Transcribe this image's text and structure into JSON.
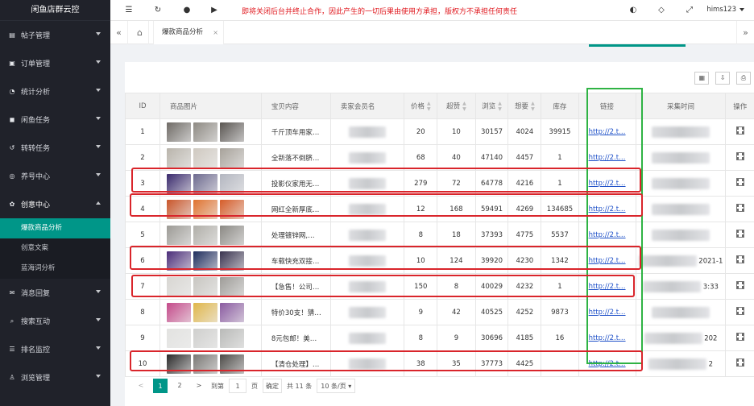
{
  "app": {
    "title": "闲鱼店群云控"
  },
  "sidebar": {
    "items": [
      {
        "label": "帖子管理",
        "icon": "doc-icon"
      },
      {
        "label": "订单管理",
        "icon": "order-icon"
      },
      {
        "label": "统计分析",
        "icon": "chart-icon"
      },
      {
        "label": "闲鱼任务",
        "icon": "task-icon"
      },
      {
        "label": "转转任务",
        "icon": "refresh-icon"
      },
      {
        "label": "养号中心",
        "icon": "account-icon"
      },
      {
        "label": "创意中心",
        "icon": "gear-icon"
      },
      {
        "label": "消息回复",
        "icon": "message-icon"
      },
      {
        "label": "搜索互动",
        "icon": "search-icon"
      },
      {
        "label": "排名监控",
        "icon": "rank-icon"
      },
      {
        "label": "浏览管理",
        "icon": "user-icon"
      }
    ],
    "sub_items": [
      {
        "label": "爆款商品分析",
        "active": true
      },
      {
        "label": "创意文案",
        "active": false
      },
      {
        "label": "蓝海词分析",
        "active": false
      }
    ]
  },
  "topbar": {
    "notice": "即将关闭后台并终止合作，因此产生的一切后果由使用方承担，版权方不承担任何责任",
    "user": "hims123"
  },
  "tabs": {
    "current": "爆款商品分析"
  },
  "table": {
    "headers": [
      "ID",
      "商品图片",
      "宝贝内容",
      "卖家会员名",
      "价格",
      "超赞",
      "浏览",
      "想要",
      "库存",
      "链接",
      "采集时间",
      "操作"
    ],
    "rows": [
      {
        "id": "1",
        "content": "千斤顶车用家…",
        "price": "20",
        "likes": "10",
        "views": "30157",
        "wants": "4024",
        "stock": "39915",
        "link": "http://2.t…",
        "time": "",
        "colors": [
          "#6f6b66",
          "#8d8982",
          "#5a5652"
        ]
      },
      {
        "id": "2",
        "content": "全新落不倒脐…",
        "price": "68",
        "likes": "40",
        "views": "47140",
        "wants": "4457",
        "stock": "1",
        "link": "http://2.t…",
        "time": "",
        "colors": [
          "#b9b4ab",
          "#cfc9c0",
          "#a7a29a"
        ]
      },
      {
        "id": "3",
        "content": "投影仪家用无…",
        "price": "279",
        "likes": "72",
        "views": "64778",
        "wants": "4216",
        "stock": "1",
        "link": "http://2.t…",
        "time": "",
        "colors": [
          "#3a2a6d",
          "#6d6a8f",
          "#b3b6c0"
        ]
      },
      {
        "id": "4",
        "content": "网红全新厚底…",
        "price": "12",
        "likes": "168",
        "views": "59491",
        "wants": "4269",
        "stock": "134685",
        "link": "http://2.t…",
        "time": "",
        "colors": [
          "#c9562a",
          "#e0732f",
          "#d65c28"
        ]
      },
      {
        "id": "5",
        "content": "处理镀锌网,…",
        "price": "8",
        "likes": "18",
        "views": "37393",
        "wants": "4775",
        "stock": "5537",
        "link": "http://2.t…",
        "time": "",
        "colors": [
          "#9c9a95",
          "#b0aea8",
          "#8b8984"
        ]
      },
      {
        "id": "6",
        "content": "车载快充双接…",
        "price": "10",
        "likes": "124",
        "views": "39920",
        "wants": "4230",
        "stock": "1342",
        "link": "http://2.t…",
        "time": "2021-1",
        "colors": [
          "#4b2d7a",
          "#1f2d5e",
          "#3a3350"
        ]
      },
      {
        "id": "7",
        "content": "【急售！公司…",
        "price": "150",
        "likes": "8",
        "views": "40029",
        "wants": "4232",
        "stock": "1",
        "link": "http://2.t…",
        "time": "3:33",
        "colors": [
          "#d8d6d2",
          "#c8c6c1",
          "#9e9c98"
        ]
      },
      {
        "id": "8",
        "content": "特价30支！猜…",
        "price": "9",
        "likes": "42",
        "views": "40525",
        "wants": "4252",
        "stock": "9873",
        "link": "http://2.t…",
        "time": "",
        "colors": [
          "#c44a8a",
          "#e0b64a",
          "#8a5aa0"
        ]
      },
      {
        "id": "9",
        "content": "8元包邮！美…",
        "price": "8",
        "likes": "9",
        "views": "30696",
        "wants": "4185",
        "stock": "16",
        "link": "http://2.t…",
        "time": "202",
        "colors": [
          "#e2e2e0",
          "#cfcfcd",
          "#b9bab8"
        ]
      },
      {
        "id": "10",
        "content": "【清仓处理】…",
        "price": "38",
        "likes": "35",
        "views": "37773",
        "wants": "4425",
        "stock": "",
        "link": "http://2.t…",
        "time": "2",
        "colors": [
          "#2b2a2a",
          "#7a7875",
          "#4d4b48"
        ]
      }
    ]
  },
  "pager": {
    "prev": "<",
    "pages": [
      "1",
      "2"
    ],
    "next": ">",
    "goto_label": "到第",
    "goto_value": "1",
    "page_unit": "页",
    "confirm": "确定",
    "total": "共 11 条",
    "size": "10 条/页"
  },
  "colors": {
    "accent": "#009688",
    "highlight_red": "#d9252b",
    "highlight_green": "#2fb344"
  }
}
